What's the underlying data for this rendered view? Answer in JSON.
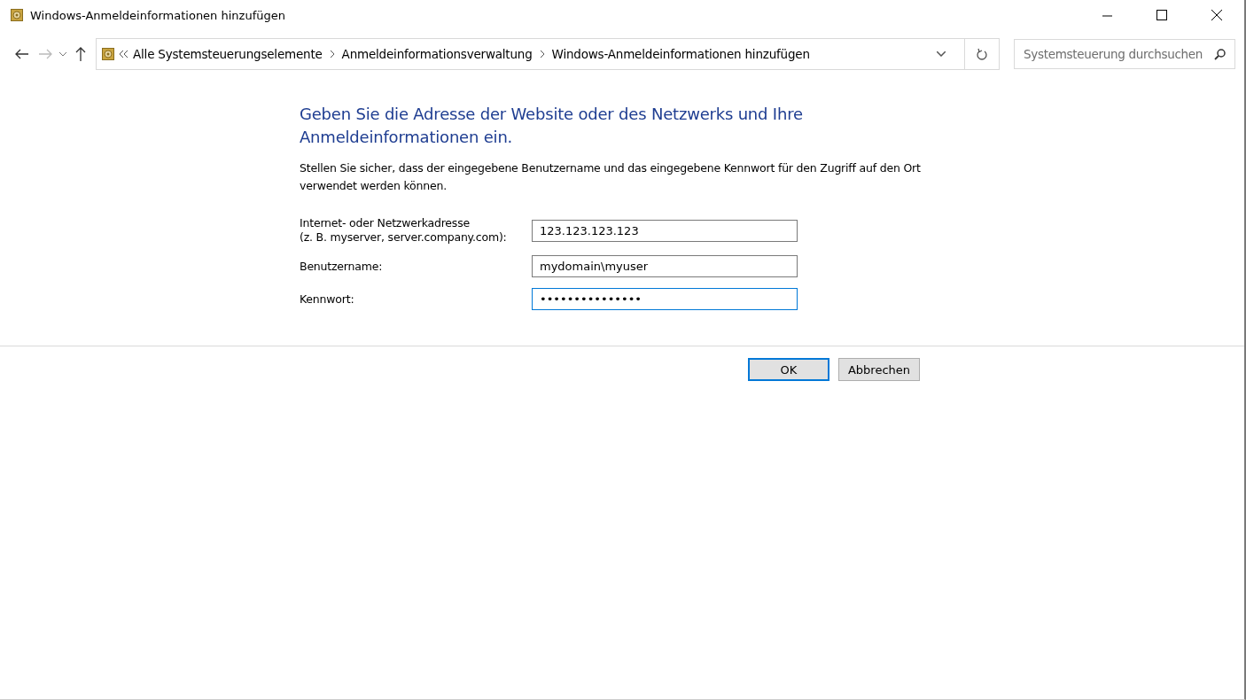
{
  "window": {
    "title": "Windows-Anmeldeinformationen hinzufügen"
  },
  "nav": {
    "breadcrumb": [
      "Alle Systemsteuerungselemente",
      "Anmeldeinformationsverwaltung",
      "Windows-Anmeldeinformationen hinzufügen"
    ],
    "search": {
      "placeholder": "Systemsteuerung durchsuchen"
    }
  },
  "heading": "Geben Sie die Adresse der Website oder des Netzwerks und Ihre Anmeldeinformationen ein.",
  "description": "Stellen Sie sicher, dass der eingegebene Benutzername und das eingegebene Kennwort für den Zugriff auf den Ort verwendet werden können.",
  "fields": [
    {
      "label": "Internet- oder Netzwerkadresse",
      "hint": "(z. B. myserver, server.company.com):",
      "value": "123.123.123.123",
      "focused": false
    },
    {
      "label": "Benutzername:",
      "value": "mydomain\\myuser",
      "focused": false
    },
    {
      "label": "Kennwort:",
      "value": "•••••••••••••••",
      "focused": true
    }
  ],
  "buttons": [
    {
      "label": "OK",
      "default": true
    },
    {
      "label": "Abbrechen",
      "default": false
    }
  ]
}
